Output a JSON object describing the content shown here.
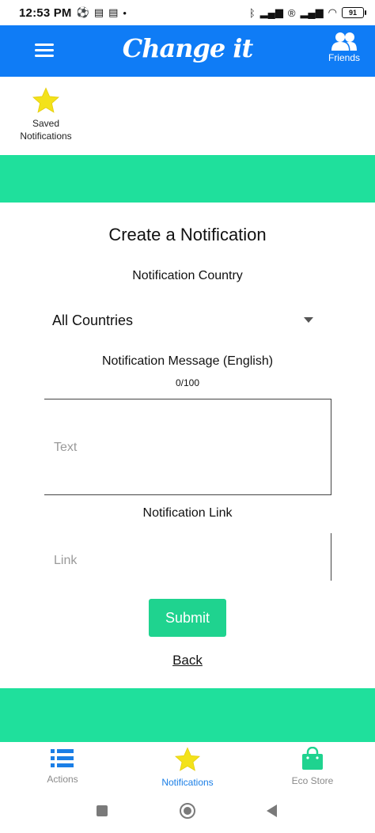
{
  "status_bar": {
    "time": "12:53 PM",
    "battery": "91",
    "icons": [
      "soccer-ball-icon",
      "news-icon",
      "news-icon",
      "dot-icon",
      "bluetooth-icon",
      "signal-icon",
      "registered-icon",
      "signal-icon",
      "wifi-icon",
      "battery-icon"
    ]
  },
  "header": {
    "logo": "Change it",
    "friends_label": "Friends",
    "menu_icon": "hamburger-menu-icon",
    "friends_icon": "people-icon",
    "color": "#0f7cf6"
  },
  "saved_notifications": {
    "label": "Saved Notifications",
    "icon": "star-icon",
    "icon_color": "#f3e21a"
  },
  "form": {
    "title": "Create a Notification",
    "country_label": "Notification Country",
    "country_value": "All Countries",
    "message_label": "Notification Message (English)",
    "char_count": "0/100",
    "message_placeholder": "Text",
    "link_label": "Notification Link",
    "link_placeholder": "Link",
    "submit_label": "Submit",
    "back_label": "Back",
    "accent_color": "#1fe09c"
  },
  "bottom_nav": {
    "items": [
      {
        "label": "Actions",
        "icon": "list-icon",
        "active": false
      },
      {
        "label": "Notifications",
        "icon": "star-icon",
        "active": true
      },
      {
        "label": "Eco Store",
        "icon": "shopping-bag-icon",
        "active": false
      }
    ]
  },
  "system_nav": {
    "icons": [
      "recent-apps-icon",
      "home-icon",
      "back-icon"
    ]
  }
}
